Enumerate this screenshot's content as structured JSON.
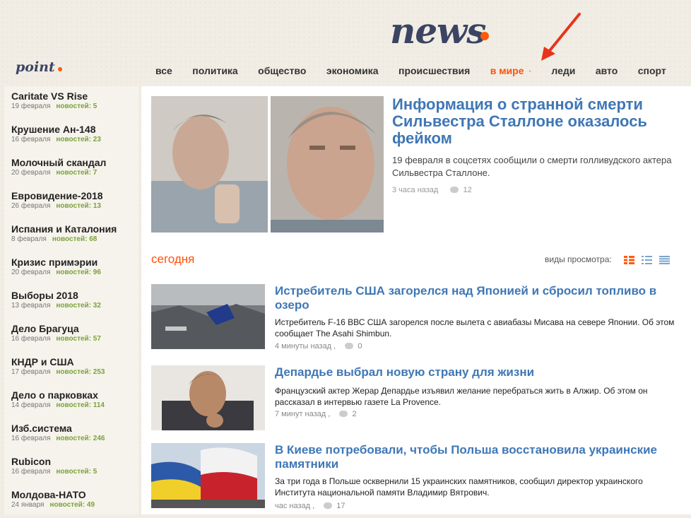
{
  "header": {
    "logo_main": "news",
    "logo_small": "point"
  },
  "nav": {
    "items": [
      {
        "label": "все"
      },
      {
        "label": "политика"
      },
      {
        "label": "общество"
      },
      {
        "label": "экономика"
      },
      {
        "label": "происшествия"
      },
      {
        "label": "в мире",
        "active": true
      },
      {
        "label": "леди"
      },
      {
        "label": "авто"
      },
      {
        "label": "спорт"
      }
    ]
  },
  "sidebar": {
    "items": [
      {
        "title": "Caritate VS Rise",
        "date": "19 февраля",
        "count": "новостей: 5"
      },
      {
        "title": "Крушение Ан-148",
        "date": "16 февраля",
        "count": "новостей: 23"
      },
      {
        "title": "Молочный скандал",
        "date": "20 февраля",
        "count": "новостей: 7"
      },
      {
        "title": "Евровидение-2018",
        "date": "26 февраля",
        "count": "новостей: 13"
      },
      {
        "title": "Испания и Каталония",
        "date": "8 февраля",
        "count": "новостей: 68"
      },
      {
        "title": "Кризис примэрии",
        "date": "20 февраля",
        "count": "новостей: 96"
      },
      {
        "title": "Выборы 2018",
        "date": "13 февраля",
        "count": "новостей: 32"
      },
      {
        "title": "Дело Брагуца",
        "date": "16 февраля",
        "count": "новостей: 57"
      },
      {
        "title": "КНДР и США",
        "date": "17 февраля",
        "count": "новостей: 253"
      },
      {
        "title": "Дело о парковках",
        "date": "14 февраля",
        "count": "новостей: 114"
      },
      {
        "title": "Изб.система",
        "date": "16 февраля",
        "count": "новостей: 246"
      },
      {
        "title": "Rubicon",
        "date": "16 февраля",
        "count": "новостей: 5"
      },
      {
        "title": "Молдова-НАТО",
        "date": "24 января",
        "count": "новостей: 49"
      }
    ]
  },
  "hero": {
    "title": "Информация о странной смерти Сильвестра Сталлоне оказалось фейком",
    "desc": "19 февраля в соцсетях сообщили о смерти голливудского актера Сильвестра Сталлоне.",
    "time": "3 часа назад",
    "comments": "12"
  },
  "section": {
    "title": "сегодня",
    "view_label": "виды просмотра:"
  },
  "articles": [
    {
      "title": "Истребитель США загорелся над Японией и сбросил топливо в озеро",
      "desc": "Истребитель F-16 ВВС США загорелся после вылета с авиабазы Мисава на севере Японии. Об этом сообщает The Asahi Shimbun.",
      "time": "4 минуты назад ,",
      "comments": "0"
    },
    {
      "title": "Депардье выбрал новую страну для жизни",
      "desc": "Французский актер Жерар Депардье изъявил желание перебраться жить в Алжир. Об этом он рассказал в интервью газете La Provence.",
      "time": "7 минут назад ,",
      "comments": "2"
    },
    {
      "title": "В Киеве потребовали, чтобы Польша восстановила украинские памятники",
      "desc": "За три года в Польше осквернили 15 украинских памятников, сообщил директор украинского Института национальной памяти Владимир Вятрович.",
      "time": "час назад ,",
      "comments": "17"
    }
  ],
  "colors": {
    "accent": "#ff4f0a",
    "link": "#3f77b6",
    "count_green": "#7aa23a",
    "logo_navy": "#3b4463"
  }
}
